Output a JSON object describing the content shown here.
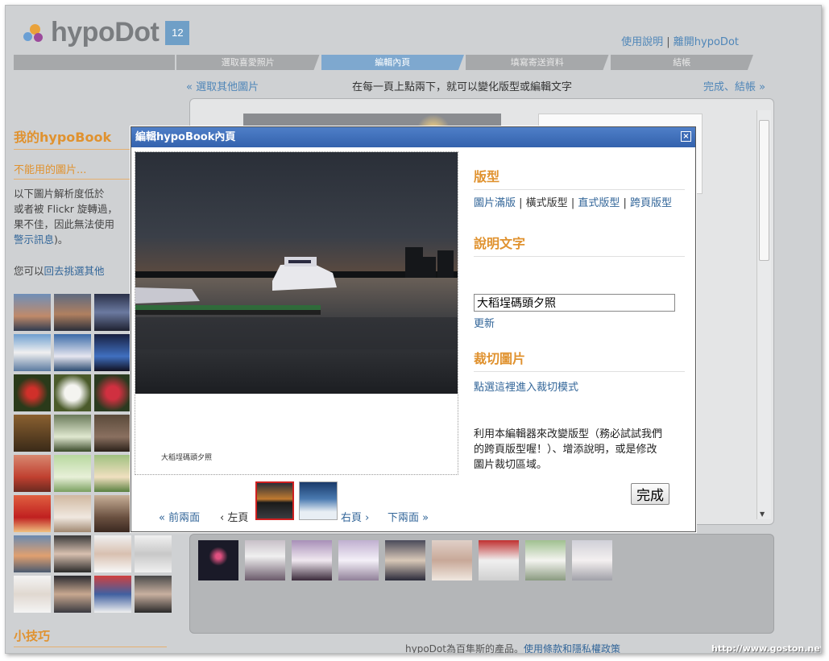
{
  "header": {
    "logo_text": "hypoDot",
    "logo_badge": "12",
    "link_help": "使用說明",
    "separator": "|",
    "link_leave": "離開hypoDot"
  },
  "steps": [
    "選取喜愛照片",
    "編輯內頁",
    "填寫寄送資料",
    "結帳"
  ],
  "subnav": {
    "back": "« 選取其他圖片",
    "hint": "在每一頁上點兩下，就可以變化版型或編輯文字",
    "finish": "完成、結帳 »"
  },
  "sidebar": {
    "title": "我的hypoBook",
    "section": "不能用的圖片...",
    "text1": "以下圖片解析度低於",
    "text2": "或者被 Flickr 旋轉過，",
    "text3": "果不佳，因此無法使用",
    "link_warn": "警示訊息",
    "text4": ")。",
    "text5_pre": "您可以",
    "link_pick": "回去挑選其他",
    "tips": "小技巧"
  },
  "dialog": {
    "title": "編輯hypoBook內頁",
    "close": "×",
    "small_caption": "大稻埕碼頭夕照",
    "prev": "« 前兩面",
    "left_page": "‹ 左頁",
    "right_page": "右頁 ›",
    "next": "下兩面 »",
    "layout_title": "版型",
    "layout_full": "圖片滿版",
    "layout_landscape": "橫式版型",
    "layout_portrait": "直式版型",
    "layout_spread": "跨頁版型",
    "caption_title": "說明文字",
    "caption_value": "大稻埕碼頭夕照",
    "update": "更新",
    "crop_title": "裁切圖片",
    "crop_link": "點選這裡進入裁切模式",
    "help": "利用本編輯器來改變版型（務必試試我們的跨頁版型喔！）、增添說明，或是修改圖片裁切區域。",
    "done": "完成"
  },
  "footer": {
    "text": "hypoDot為百隼斯的產品。",
    "link": "使用條款和隱私權政策"
  },
  "watermark": "http://www.goston.net/",
  "colors": {
    "accent_orange": "#e0922f",
    "link_blue": "#336699",
    "title_blue": "#3362ad",
    "background": "#cfd1d3"
  }
}
